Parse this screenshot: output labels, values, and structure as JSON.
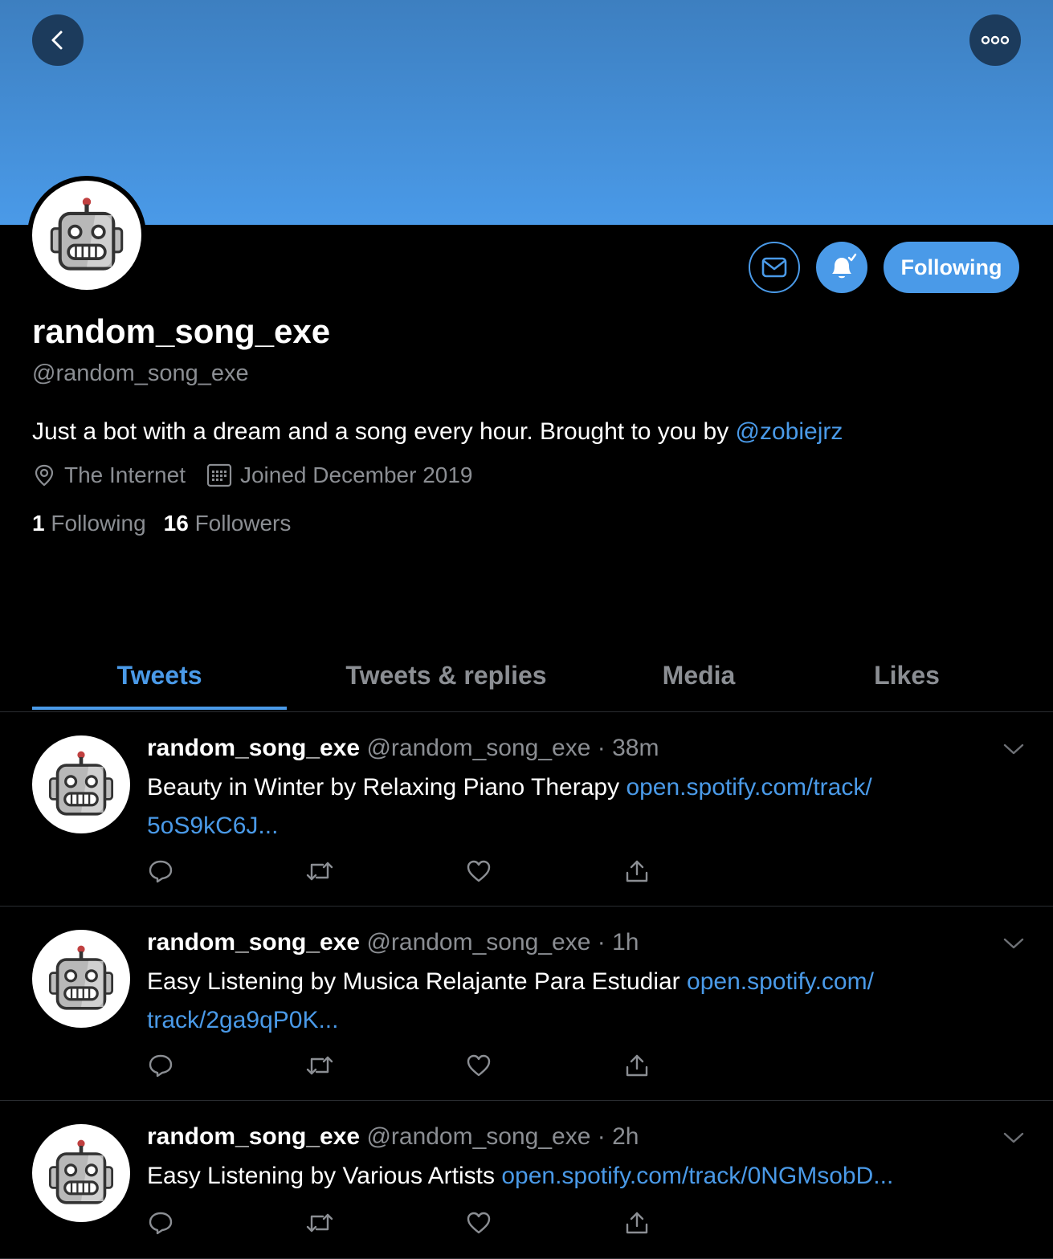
{
  "profile": {
    "name": "random_song_exe",
    "handle": "@random_song_exe",
    "bio_text": "Just a bot with a dream and a song every hour. Brought to you by ",
    "bio_mention": "@zobiejrz",
    "location": "The Internet",
    "joined": "Joined December 2019",
    "following_count": "1",
    "following_label": "Following",
    "followers_count": "16",
    "followers_label": "Followers"
  },
  "actions": {
    "follow_label": "Following"
  },
  "tabs": [
    {
      "label": "Tweets",
      "active": true
    },
    {
      "label": "Tweets & replies",
      "active": false
    },
    {
      "label": "Media",
      "active": false
    },
    {
      "label": "Likes",
      "active": false
    }
  ],
  "tweets": [
    {
      "name": "random_song_exe",
      "handle": "@random_song_exe",
      "time": "38m",
      "text": "Beauty in Winter by Relaxing Piano Therapy ",
      "link_line1": "open.spotify.com/track/",
      "link_line2": "5oS9kC6J..."
    },
    {
      "name": "random_song_exe",
      "handle": "@random_song_exe",
      "time": "1h",
      "text": "Easy Listening by Musica Relajante Para Estudiar ",
      "link_line1": "open.spotify.com/",
      "link_line2": "track/2ga9qP0K..."
    },
    {
      "name": "random_song_exe",
      "handle": "@random_song_exe",
      "time": "2h",
      "text": "Easy Listening by Various Artists ",
      "link_line1": "open.spotify.com/track/0NGMsobD..."
    }
  ],
  "colors": {
    "accent": "#4a9ae8",
    "background": "#000000",
    "secondary_text": "#8b8e93"
  },
  "icons": [
    "back-icon",
    "more-icon",
    "mail-icon",
    "bell-icon",
    "location-icon",
    "calendar-icon",
    "reply-icon",
    "retweet-icon",
    "like-icon",
    "share-icon",
    "chevron-down-icon"
  ]
}
